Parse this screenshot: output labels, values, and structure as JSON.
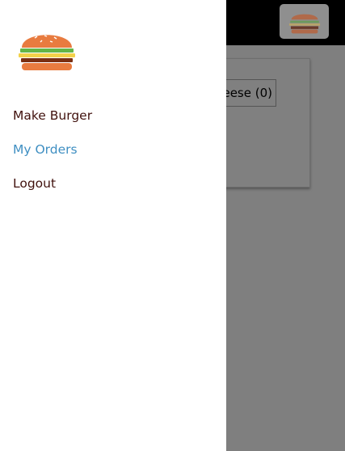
{
  "colors": {
    "nav_text": "#40110d",
    "nav_active": "#3f8fc2",
    "backdrop": "#7f7f7f",
    "toolbar": "#000000",
    "bun": "#e87b3f",
    "lettuce": "#63b547",
    "cheese": "#f3d24a",
    "meat": "#7a2f12"
  },
  "background": {
    "ingredient_button_label": "eese (0)"
  },
  "drawer": {
    "logo_icon": "burger-logo",
    "nav": [
      {
        "label": "Make Burger",
        "active": false
      },
      {
        "label": "My Orders",
        "active": true
      },
      {
        "label": "Logout",
        "active": false
      }
    ]
  }
}
